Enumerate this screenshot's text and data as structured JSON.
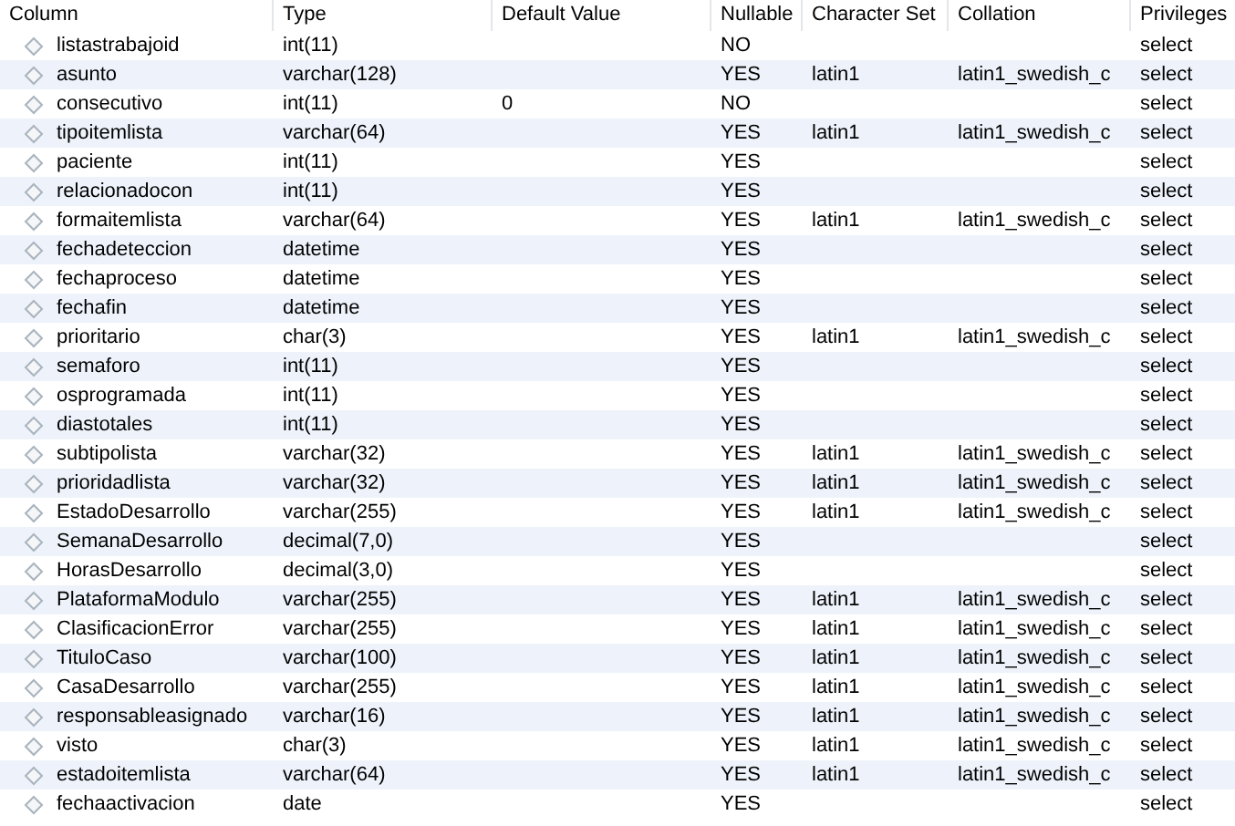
{
  "table": {
    "columns": [
      "Column",
      "Type",
      "Default Value",
      "Nullable",
      "Character Set",
      "Collation",
      "Privileges"
    ],
    "rows": [
      {
        "column": "listastrabajoid",
        "type": "int(11)",
        "default": "",
        "nullable": "NO",
        "charset": "",
        "collation": "",
        "privileges": "select"
      },
      {
        "column": "asunto",
        "type": "varchar(128)",
        "default": "",
        "nullable": "YES",
        "charset": "latin1",
        "collation": "latin1_swedish_c",
        "privileges": "select"
      },
      {
        "column": "consecutivo",
        "type": "int(11)",
        "default": "0",
        "nullable": "NO",
        "charset": "",
        "collation": "",
        "privileges": "select"
      },
      {
        "column": "tipoitemlista",
        "type": "varchar(64)",
        "default": "",
        "nullable": "YES",
        "charset": "latin1",
        "collation": "latin1_swedish_c",
        "privileges": "select"
      },
      {
        "column": "paciente",
        "type": "int(11)",
        "default": "",
        "nullable": "YES",
        "charset": "",
        "collation": "",
        "privileges": "select"
      },
      {
        "column": "relacionadocon",
        "type": "int(11)",
        "default": "",
        "nullable": "YES",
        "charset": "",
        "collation": "",
        "privileges": "select"
      },
      {
        "column": "formaitemlista",
        "type": "varchar(64)",
        "default": "",
        "nullable": "YES",
        "charset": "latin1",
        "collation": "latin1_swedish_c",
        "privileges": "select"
      },
      {
        "column": "fechadeteccion",
        "type": "datetime",
        "default": "",
        "nullable": "YES",
        "charset": "",
        "collation": "",
        "privileges": "select"
      },
      {
        "column": "fechaproceso",
        "type": "datetime",
        "default": "",
        "nullable": "YES",
        "charset": "",
        "collation": "",
        "privileges": "select"
      },
      {
        "column": "fechafin",
        "type": "datetime",
        "default": "",
        "nullable": "YES",
        "charset": "",
        "collation": "",
        "privileges": "select"
      },
      {
        "column": "prioritario",
        "type": "char(3)",
        "default": "",
        "nullable": "YES",
        "charset": "latin1",
        "collation": "latin1_swedish_c",
        "privileges": "select"
      },
      {
        "column": "semaforo",
        "type": "int(11)",
        "default": "",
        "nullable": "YES",
        "charset": "",
        "collation": "",
        "privileges": "select"
      },
      {
        "column": "osprogramada",
        "type": "int(11)",
        "default": "",
        "nullable": "YES",
        "charset": "",
        "collation": "",
        "privileges": "select"
      },
      {
        "column": "diastotales",
        "type": "int(11)",
        "default": "",
        "nullable": "YES",
        "charset": "",
        "collation": "",
        "privileges": "select"
      },
      {
        "column": "subtipolista",
        "type": "varchar(32)",
        "default": "",
        "nullable": "YES",
        "charset": "latin1",
        "collation": "latin1_swedish_c",
        "privileges": "select"
      },
      {
        "column": "prioridadlista",
        "type": "varchar(32)",
        "default": "",
        "nullable": "YES",
        "charset": "latin1",
        "collation": "latin1_swedish_c",
        "privileges": "select"
      },
      {
        "column": "EstadoDesarrollo",
        "type": "varchar(255)",
        "default": "",
        "nullable": "YES",
        "charset": "latin1",
        "collation": "latin1_swedish_c",
        "privileges": "select"
      },
      {
        "column": "SemanaDesarrollo",
        "type": "decimal(7,0)",
        "default": "",
        "nullable": "YES",
        "charset": "",
        "collation": "",
        "privileges": "select"
      },
      {
        "column": "HorasDesarrollo",
        "type": "decimal(3,0)",
        "default": "",
        "nullable": "YES",
        "charset": "",
        "collation": "",
        "privileges": "select"
      },
      {
        "column": "PlataformaModulo",
        "type": "varchar(255)",
        "default": "",
        "nullable": "YES",
        "charset": "latin1",
        "collation": "latin1_swedish_c",
        "privileges": "select"
      },
      {
        "column": "ClasificacionError",
        "type": "varchar(255)",
        "default": "",
        "nullable": "YES",
        "charset": "latin1",
        "collation": "latin1_swedish_c",
        "privileges": "select"
      },
      {
        "column": "TituloCaso",
        "type": "varchar(100)",
        "default": "",
        "nullable": "YES",
        "charset": "latin1",
        "collation": "latin1_swedish_c",
        "privileges": "select"
      },
      {
        "column": "CasaDesarrollo",
        "type": "varchar(255)",
        "default": "",
        "nullable": "YES",
        "charset": "latin1",
        "collation": "latin1_swedish_c",
        "privileges": "select"
      },
      {
        "column": "responsableasignado",
        "type": "varchar(16)",
        "default": "",
        "nullable": "YES",
        "charset": "latin1",
        "collation": "latin1_swedish_c",
        "privileges": "select"
      },
      {
        "column": "visto",
        "type": "char(3)",
        "default": "",
        "nullable": "YES",
        "charset": "latin1",
        "collation": "latin1_swedish_c",
        "privileges": "select"
      },
      {
        "column": "estadoitemlista",
        "type": "varchar(64)",
        "default": "",
        "nullable": "YES",
        "charset": "latin1",
        "collation": "latin1_swedish_c",
        "privileges": "select"
      },
      {
        "column": "fechaactivacion",
        "type": "date",
        "default": "",
        "nullable": "YES",
        "charset": "",
        "collation": "",
        "privileges": "select"
      }
    ]
  }
}
